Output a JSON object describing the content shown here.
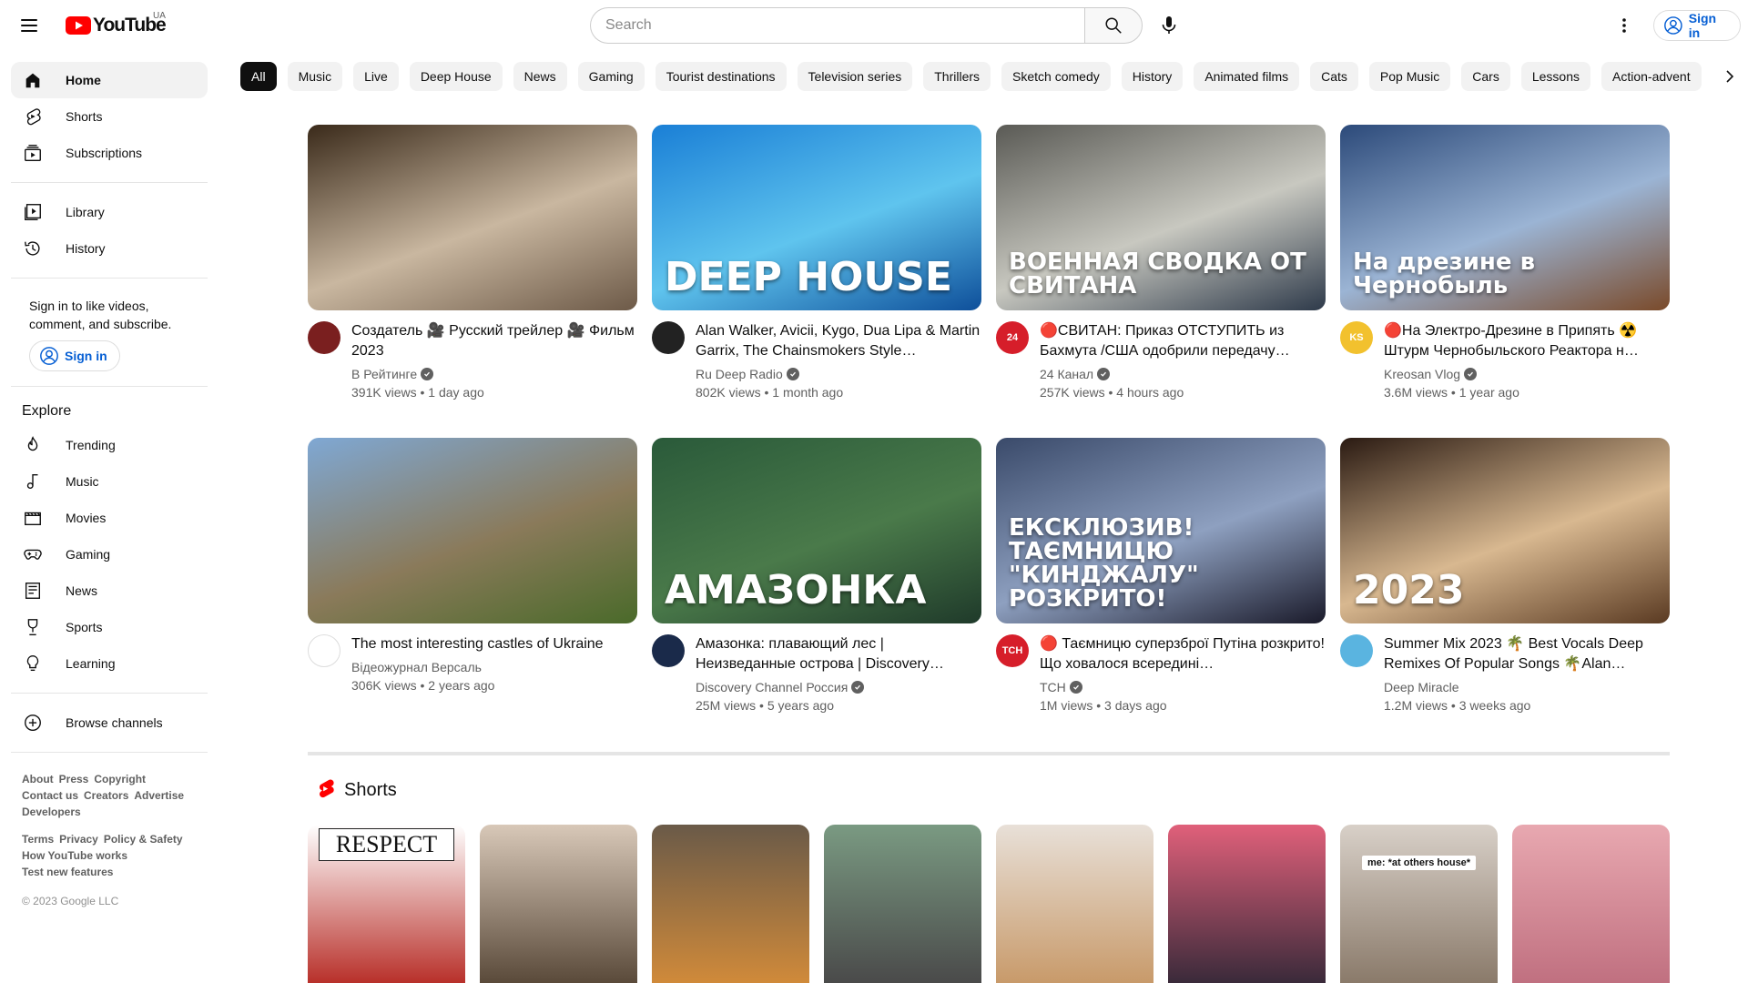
{
  "masthead": {
    "logo_text": "YouTube",
    "country": "UA",
    "search_placeholder": "Search",
    "signin": "Sign in"
  },
  "sidebar": {
    "primary": [
      {
        "label": "Home",
        "icon": "home-icon",
        "active": true
      },
      {
        "label": "Shorts",
        "icon": "shorts-icon"
      },
      {
        "label": "Subscriptions",
        "icon": "subscriptions-icon"
      }
    ],
    "secondary": [
      {
        "label": "Library",
        "icon": "library-icon"
      },
      {
        "label": "History",
        "icon": "history-icon"
      }
    ],
    "signin_note": "Sign in to like videos, comment, and subscribe.",
    "signin_button": "Sign in",
    "explore_heading": "Explore",
    "explore": [
      {
        "label": "Trending",
        "icon": "trending-icon"
      },
      {
        "label": "Music",
        "icon": "music-icon"
      },
      {
        "label": "Movies",
        "icon": "movies-icon"
      },
      {
        "label": "Gaming",
        "icon": "gaming-icon"
      },
      {
        "label": "News",
        "icon": "news-icon"
      },
      {
        "label": "Sports",
        "icon": "sports-icon"
      },
      {
        "label": "Learning",
        "icon": "learning-icon"
      }
    ],
    "browse_channels": "Browse channels",
    "footer_row1": [
      "About",
      "Press",
      "Copyright"
    ],
    "footer_row2": [
      "Contact us",
      "Creators",
      "Advertise"
    ],
    "footer_row3": [
      "Developers"
    ],
    "footer_row4": [
      "Terms",
      "Privacy",
      "Policy & Safety"
    ],
    "footer_row5": [
      "How YouTube works"
    ],
    "footer_row6": [
      "Test new features"
    ],
    "copyright": "© 2023 Google LLC"
  },
  "chips": [
    "All",
    "Music",
    "Live",
    "Deep House",
    "News",
    "Gaming",
    "Tourist destinations",
    "Television series",
    "Thrillers",
    "Sketch comedy",
    "History",
    "Animated films",
    "Cats",
    "Pop Music",
    "Cars",
    "Lessons",
    "Action-advent"
  ],
  "videos": [
    {
      "title": "Создатель 🎥 Русский трейлер 🎥 Фильм 2023",
      "channel": "В Рейтинге",
      "verified": true,
      "views": "391K views",
      "age": "1 day ago",
      "thumb_text": "",
      "thumb_colors": [
        "#3a2a1a",
        "#c9b7a0",
        "#6d5a48"
      ],
      "avatar_color": "#7a1f1f",
      "avatar_text": ""
    },
    {
      "title": "Alan Walker, Avicii, Kygo, Dua Lipa & Martin Garrix, The Chainsmokers Style…",
      "channel": "Ru Deep Radio",
      "verified": true,
      "views": "802K views",
      "age": "1 month ago",
      "thumb_text": "DEEP HOUSE",
      "thumb_colors": [
        "#1a7fd6",
        "#5fc4ee",
        "#0e4f9a"
      ],
      "avatar_color": "#222222",
      "avatar_text": ""
    },
    {
      "title": "🔴СВИТАН: Приказ ОТСТУПИТЬ из Бахмута /США одобрили передачу…",
      "channel": "24 Канал",
      "verified": true,
      "views": "257K views",
      "age": "4 hours ago",
      "thumb_text": "ВОЕННАЯ СВОДКА ОТ СВИТАНА",
      "thumb_colors": [
        "#5a5a55",
        "#c8c8c0",
        "#2e3a4a"
      ],
      "avatar_color": "#d61e2a",
      "avatar_text": "24"
    },
    {
      "title": "🔴На Электро-Дрезине в Припять ☢️ Штурм Чернобыльского Реактора н…",
      "channel": "Kreosan Vlog",
      "verified": true,
      "views": "3.6M views",
      "age": "1 year ago",
      "thumb_text": "На дрезине в Чернобыль",
      "thumb_colors": [
        "#2c4a7a",
        "#9bb4d4",
        "#7a4a2a"
      ],
      "avatar_color": "#f2c12e",
      "avatar_text": "KS"
    },
    {
      "title": "The most interesting castles of Ukraine",
      "channel": "Відеожурнал Версаль",
      "verified": false,
      "views": "306K views",
      "age": "2 years ago",
      "thumb_text": "",
      "thumb_colors": [
        "#7fa8d4",
        "#8a7a5a",
        "#4a6a2a"
      ],
      "avatar_color": "#ffffff",
      "avatar_text": ""
    },
    {
      "title": "Амазонка: плавающий лес | Неизведанные острова | Discovery…",
      "channel": "Discovery Channel Россия",
      "verified": true,
      "views": "25M views",
      "age": "5 years ago",
      "thumb_text": "АМАЗОНКА",
      "thumb_colors": [
        "#2a5a3a",
        "#4a7a4a",
        "#1f3a2a"
      ],
      "avatar_color": "#1a2a4a",
      "avatar_text": ""
    },
    {
      "title": "🔴 Таємницю суперзброї Путіна розкрито! Що ховалося всередині…",
      "channel": "ТСН",
      "verified": true,
      "views": "1M views",
      "age": "3 days ago",
      "thumb_text": "ЕКСКЛЮЗИВ! ТАЄМНИЦЮ \"КИНДЖАЛУ\" РОЗКРИТО!",
      "thumb_colors": [
        "#3a4a6a",
        "#8ea0c0",
        "#1a1a2a"
      ],
      "avatar_color": "#d61e2a",
      "avatar_text": "ТСН"
    },
    {
      "title": "Summer Mix 2023 🌴 Best Vocals Deep Remixes Of Popular Songs 🌴Alan…",
      "channel": "Deep Miracle",
      "verified": false,
      "views": "1.2M views",
      "age": "3 weeks ago",
      "thumb_text": "2023",
      "thumb_colors": [
        "#2a1a12",
        "#d8b890",
        "#5a3a22"
      ],
      "avatar_color": "#5ab4e0",
      "avatar_text": ""
    }
  ],
  "shorts": {
    "heading": "Shorts",
    "items": [
      {
        "colors": [
          "#ffffff",
          "#b8302a"
        ],
        "caption": "RESPECT"
      },
      {
        "colors": [
          "#d8c8b8",
          "#5a4a3a"
        ],
        "caption": ""
      },
      {
        "colors": [
          "#6a5a48",
          "#d08a3a"
        ],
        "caption": ""
      },
      {
        "colors": [
          "#7a9a82",
          "#4a4a4a"
        ],
        "caption": ""
      },
      {
        "colors": [
          "#e8e0d8",
          "#c89a6a"
        ],
        "caption": ""
      },
      {
        "colors": [
          "#e0607a",
          "#3a2a3a"
        ],
        "caption": ""
      },
      {
        "colors": [
          "#d8d0c8",
          "#8a7a6a"
        ],
        "caption": "me: *at others house*"
      },
      {
        "colors": [
          "#e8a8b0",
          "#c07080"
        ],
        "caption": ""
      }
    ]
  }
}
